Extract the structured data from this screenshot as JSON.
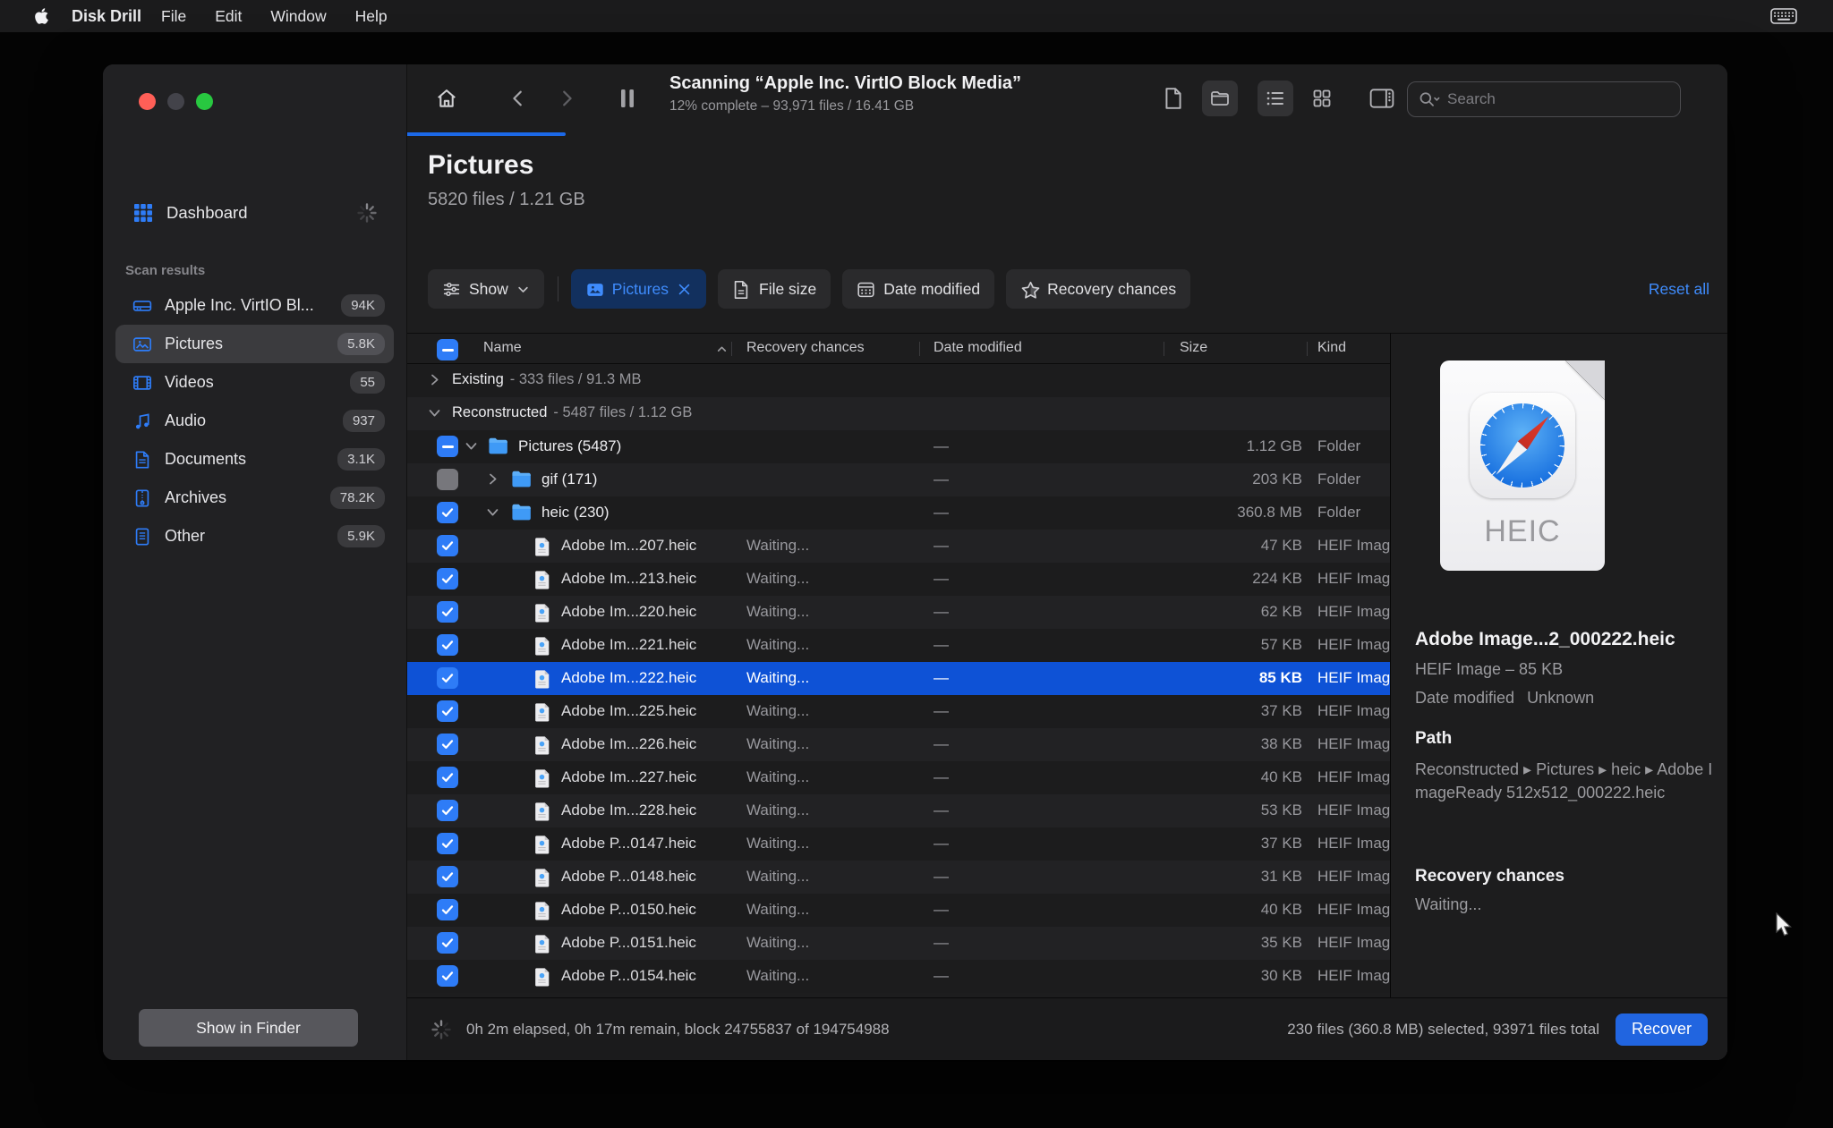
{
  "menu_bar": {
    "app": "Disk Drill",
    "items": [
      "File",
      "Edit",
      "Window",
      "Help"
    ],
    "status_icons": [
      "keyboard-icon"
    ]
  },
  "window": {
    "toolbar": {
      "nav_icons": [
        "home-icon",
        "back-icon",
        "forward-icon",
        "pause-icon"
      ],
      "title": "Scanning “Apple Inc. VirtIO Block Media”",
      "subtitle": "12% complete – 93,971 files / 16.41 GB",
      "progress_percent": 12,
      "view_icons": [
        {
          "icon": "new-file-icon",
          "active": false
        },
        {
          "icon": "folder-view-icon",
          "active": true
        },
        {
          "icon": "list-view-icon",
          "active": true
        },
        {
          "icon": "grid-view-icon",
          "active": false
        },
        {
          "icon": "preview-panel-icon",
          "active": false
        }
      ],
      "search_placeholder": "Search"
    },
    "sidebar": {
      "dashboard_label": "Dashboard",
      "section_label": "Scan results",
      "items": [
        {
          "label": "Apple Inc. VirtIO Bl...",
          "count": "94K",
          "icon": "drive-icon",
          "selected": false
        },
        {
          "label": "Pictures",
          "count": "5.8K",
          "icon": "pictures-icon",
          "selected": true
        },
        {
          "label": "Videos",
          "count": "55",
          "icon": "videos-icon",
          "selected": false
        },
        {
          "label": "Audio",
          "count": "937",
          "icon": "audio-icon",
          "selected": false
        },
        {
          "label": "Documents",
          "count": "3.1K",
          "icon": "documents-icon",
          "selected": false
        },
        {
          "label": "Archives",
          "count": "78.2K",
          "icon": "archives-icon",
          "selected": false
        },
        {
          "label": "Other",
          "count": "5.9K",
          "icon": "other-icon",
          "selected": false
        }
      ],
      "show_in_finder_label": "Show in Finder"
    },
    "content": {
      "title": "Pictures",
      "subtitle": "5820 files / 1.21 GB",
      "filters": {
        "show_label": "Show",
        "chips": [
          {
            "label": "Pictures",
            "icon": "pictures-chip-icon",
            "active": true
          },
          {
            "label": "File size",
            "icon": "file-size-icon",
            "active": false
          },
          {
            "label": "Date modified",
            "icon": "calendar-icon",
            "active": false
          },
          {
            "label": "Recovery chances",
            "icon": "star-icon",
            "active": false
          }
        ],
        "reset_label": "Reset all"
      },
      "table": {
        "columns": [
          "Name",
          "Recovery chances",
          "Date modified",
          "Size",
          "Kind"
        ],
        "rows": [
          {
            "type": "group",
            "name": "Existing",
            "meta": "- 333 files / 91.3 MB",
            "expanded": false
          },
          {
            "type": "group",
            "name": "Reconstructed",
            "meta": "- 5487 files / 1.12 GB",
            "expanded": true
          },
          {
            "type": "folder",
            "level": 1,
            "name": "Pictures (5487)",
            "date": "—",
            "size": "1.12 GB",
            "kind": "Folder",
            "check": "mixed",
            "expanded": true
          },
          {
            "type": "folder",
            "level": 2,
            "name": "gif (171)",
            "date": "—",
            "size": "203 KB",
            "kind": "Folder",
            "check": "off",
            "expanded": false
          },
          {
            "type": "folder",
            "level": 2,
            "name": "heic (230)",
            "date": "—",
            "size": "360.8 MB",
            "kind": "Folder",
            "check": "on",
            "expanded": true
          },
          {
            "type": "file",
            "level": 3,
            "name": "Adobe Im...207.heic",
            "recovery": "Waiting...",
            "date": "—",
            "size": "47 KB",
            "kind": "HEIF Image",
            "check": "on"
          },
          {
            "type": "file",
            "level": 3,
            "name": "Adobe Im...213.heic",
            "recovery": "Waiting...",
            "date": "—",
            "size": "224 KB",
            "kind": "HEIF Image",
            "check": "on"
          },
          {
            "type": "file",
            "level": 3,
            "name": "Adobe Im...220.heic",
            "recovery": "Waiting...",
            "date": "—",
            "size": "62 KB",
            "kind": "HEIF Image",
            "check": "on"
          },
          {
            "type": "file",
            "level": 3,
            "name": "Adobe Im...221.heic",
            "recovery": "Waiting...",
            "date": "—",
            "size": "57 KB",
            "kind": "HEIF Image",
            "check": "on"
          },
          {
            "type": "file",
            "level": 3,
            "name": "Adobe Im...222.heic",
            "recovery": "Waiting...",
            "date": "—",
            "size": "85 KB",
            "kind": "HEIF Image",
            "check": "on",
            "selected": true
          },
          {
            "type": "file",
            "level": 3,
            "name": "Adobe Im...225.heic",
            "recovery": "Waiting...",
            "date": "—",
            "size": "37 KB",
            "kind": "HEIF Image",
            "check": "on"
          },
          {
            "type": "file",
            "level": 3,
            "name": "Adobe Im...226.heic",
            "recovery": "Waiting...",
            "date": "—",
            "size": "38 KB",
            "kind": "HEIF Image",
            "check": "on"
          },
          {
            "type": "file",
            "level": 3,
            "name": "Adobe Im...227.heic",
            "recovery": "Waiting...",
            "date": "—",
            "size": "40 KB",
            "kind": "HEIF Image",
            "check": "on"
          },
          {
            "type": "file",
            "level": 3,
            "name": "Adobe Im...228.heic",
            "recovery": "Waiting...",
            "date": "—",
            "size": "53 KB",
            "kind": "HEIF Image",
            "check": "on"
          },
          {
            "type": "file",
            "level": 3,
            "name": "Adobe P...0147.heic",
            "recovery": "Waiting...",
            "date": "—",
            "size": "37 KB",
            "kind": "HEIF Image",
            "check": "on"
          },
          {
            "type": "file",
            "level": 3,
            "name": "Adobe P...0148.heic",
            "recovery": "Waiting...",
            "date": "—",
            "size": "31 KB",
            "kind": "HEIF Image",
            "check": "on"
          },
          {
            "type": "file",
            "level": 3,
            "name": "Adobe P...0150.heic",
            "recovery": "Waiting...",
            "date": "—",
            "size": "40 KB",
            "kind": "HEIF Image",
            "check": "on"
          },
          {
            "type": "file",
            "level": 3,
            "name": "Adobe P...0151.heic",
            "recovery": "Waiting...",
            "date": "—",
            "size": "35 KB",
            "kind": "HEIF Image",
            "check": "on"
          },
          {
            "type": "file",
            "level": 3,
            "name": "Adobe P...0154.heic",
            "recovery": "Waiting...",
            "date": "—",
            "size": "30 KB",
            "kind": "HEIF Image",
            "check": "on"
          }
        ]
      },
      "status_bar": {
        "left": "0h 2m elapsed, 0h 17m remain, block 24755837 of 194754988",
        "right": "230 files (360.8 MB) selected, 93971 files total",
        "recover_label": "Recover"
      }
    },
    "preview": {
      "icon_badge": "HEIC",
      "file_name": "Adobe Image...2_000222.heic",
      "file_info": "HEIF Image – 85 KB",
      "date_modified_label": "Date modified",
      "date_modified_value": "Unknown",
      "path_label": "Path",
      "path_value": "Reconstructed ▸ Pictures ▸ heic ▸ Adobe ImageReady 512x512_000222.heic",
      "recovery_label": "Recovery chances",
      "recovery_value": "Waiting..."
    }
  }
}
